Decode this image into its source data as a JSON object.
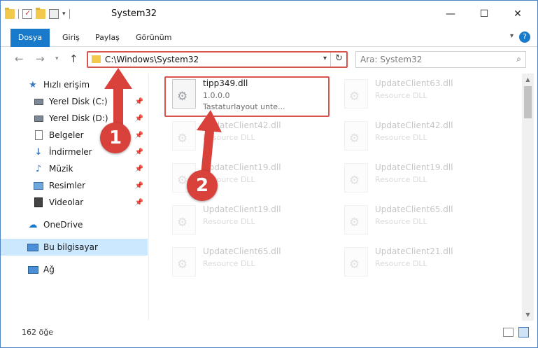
{
  "window": {
    "title": "System32",
    "controls": {
      "minimize": "—",
      "maximize": "☐",
      "close": "✕"
    }
  },
  "ribbon": {
    "tabs": [
      "Dosya",
      "Giriş",
      "Paylaş",
      "Görünüm"
    ],
    "help": "?"
  },
  "address": {
    "path": "C:\\Windows\\System32",
    "search_placeholder": "Ara: System32"
  },
  "nav": {
    "items": [
      {
        "label": "Hızlı erişim",
        "icon": "star-icon",
        "pinned": false
      },
      {
        "label": "Yerel Disk (C:)",
        "icon": "drive-icon",
        "pinned": true
      },
      {
        "label": "Yerel Disk (D:)",
        "icon": "drive-icon",
        "pinned": true
      },
      {
        "label": "Belgeler",
        "icon": "document-icon",
        "pinned": true
      },
      {
        "label": "İndirmeler",
        "icon": "download-icon",
        "pinned": true
      },
      {
        "label": "Müzik",
        "icon": "music-icon",
        "pinned": true
      },
      {
        "label": "Resimler",
        "icon": "pictures-icon",
        "pinned": true
      },
      {
        "label": "Videolar",
        "icon": "videos-icon",
        "pinned": true
      },
      {
        "label": "OneDrive",
        "icon": "cloud-icon",
        "pinned": false
      },
      {
        "label": "Bu bilgisayar",
        "icon": "computer-icon",
        "pinned": false,
        "selected": true
      },
      {
        "label": "Ağ",
        "icon": "network-icon",
        "pinned": false
      }
    ]
  },
  "files": [
    {
      "name": "tipp349.dll",
      "line2": "1.0.0.0",
      "line3": "Tastaturlayout unte...",
      "highlighted": true
    },
    {
      "name": "UpdateClient63.dll",
      "line2": "Resource DLL"
    },
    {
      "name": "UpdateClient42.dll",
      "line2": "Resource DLL"
    },
    {
      "name": "UpdateClient42.dll",
      "line2": "Resource DLL"
    },
    {
      "name": "UpdateClient19.dll",
      "line2": "Resource DLL"
    },
    {
      "name": "UpdateClient19.dll",
      "line2": "Resource DLL"
    },
    {
      "name": "UpdateClient19.dll",
      "line2": "Resource DLL"
    },
    {
      "name": "UpdateClient65.dll",
      "line2": "Resource DLL"
    },
    {
      "name": "UpdateClient65.dll",
      "line2": "Resource DLL"
    },
    {
      "name": "UpdateClient21.dll",
      "line2": "Resource DLL"
    }
  ],
  "status": {
    "item_count": "162 öğe"
  },
  "annotations": {
    "badge1": "1",
    "badge2": "2",
    "color": "#d9413b"
  }
}
